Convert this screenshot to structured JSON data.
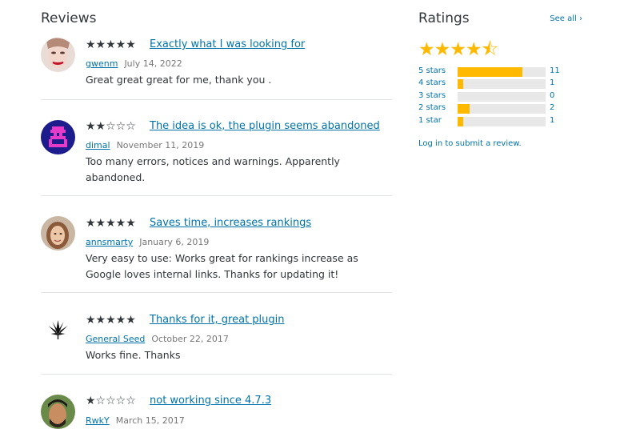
{
  "reviews_heading": "Reviews",
  "reviews": [
    {
      "rating": 5,
      "stars": "★★★★★",
      "title": "Exactly what I was looking for",
      "author": "gwenm",
      "date": "July 14, 2022",
      "content": "Great great great for me, thank you ."
    },
    {
      "rating": 2,
      "stars": "★★☆☆☆",
      "title": "The idea is ok, the plugin seems abandoned",
      "author": "dimal",
      "date": "November 11, 2019",
      "content": "Too many errors, notices and warnings. Apparently abandoned."
    },
    {
      "rating": 5,
      "stars": "★★★★★",
      "title": "Saves time, increases rankings",
      "author": "annsmarty",
      "date": "January 6, 2019",
      "content": "Very easy to use: Works great for rankings increase as Google loves internal links. Thanks for updating it!"
    },
    {
      "rating": 5,
      "stars": "★★★★★",
      "title": "Thanks for it, great plugin",
      "author": "General Seed",
      "date": "October 22, 2017",
      "content": "Works fine. Thanks"
    },
    {
      "rating": 1,
      "stars": "★☆☆☆☆",
      "title": "not working since 4.7.3",
      "author": "RwkY",
      "date": "March 15, 2017",
      "content": ""
    }
  ],
  "ratings": {
    "heading": "Ratings",
    "see_all": "See all ›",
    "average_stars": "★★★★⯪",
    "rows": [
      {
        "label": "5 stars",
        "count": "11",
        "fraction": 0.7333
      },
      {
        "label": "4 stars",
        "count": "1",
        "fraction": 0.0667
      },
      {
        "label": "3 stars",
        "count": "0",
        "fraction": 0
      },
      {
        "label": "2 stars",
        "count": "2",
        "fraction": 0.1333
      },
      {
        "label": "1 star",
        "count": "1",
        "fraction": 0.0667
      }
    ],
    "login_text": "Log in to submit a review."
  },
  "colors": {
    "accent": "#0073aa",
    "star": "#ffb900"
  }
}
